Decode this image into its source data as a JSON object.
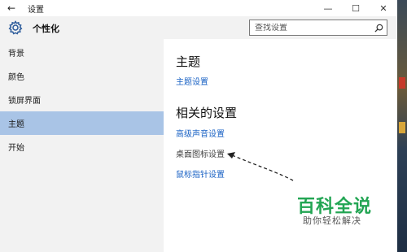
{
  "window": {
    "title": "设置",
    "back_glyph": "←",
    "controls": {
      "minimize": "—",
      "maximize": "☐",
      "close": "✕"
    }
  },
  "header": {
    "icon": "gear-icon",
    "title": "个性化",
    "search_placeholder": "查找设置",
    "search_icon": "search-icon"
  },
  "sidebar": {
    "items": [
      {
        "label": "背景",
        "active": false
      },
      {
        "label": "颜色",
        "active": false
      },
      {
        "label": "锁屏界面",
        "active": false
      },
      {
        "label": "主题",
        "active": true
      },
      {
        "label": "开始",
        "active": false
      }
    ]
  },
  "main": {
    "theme_heading": "主题",
    "theme_link": "主题设置",
    "related_heading": "相关的设置",
    "related_links": [
      "高级声音设置",
      "桌面图标设置",
      "鼠标指针设置"
    ]
  },
  "watermark": {
    "main": "百科全说",
    "sub": "助你轻松解决"
  },
  "colors": {
    "accent": "#1a62c4",
    "active_nav": "#a9c4e6",
    "watermark_green": "#22a553"
  }
}
